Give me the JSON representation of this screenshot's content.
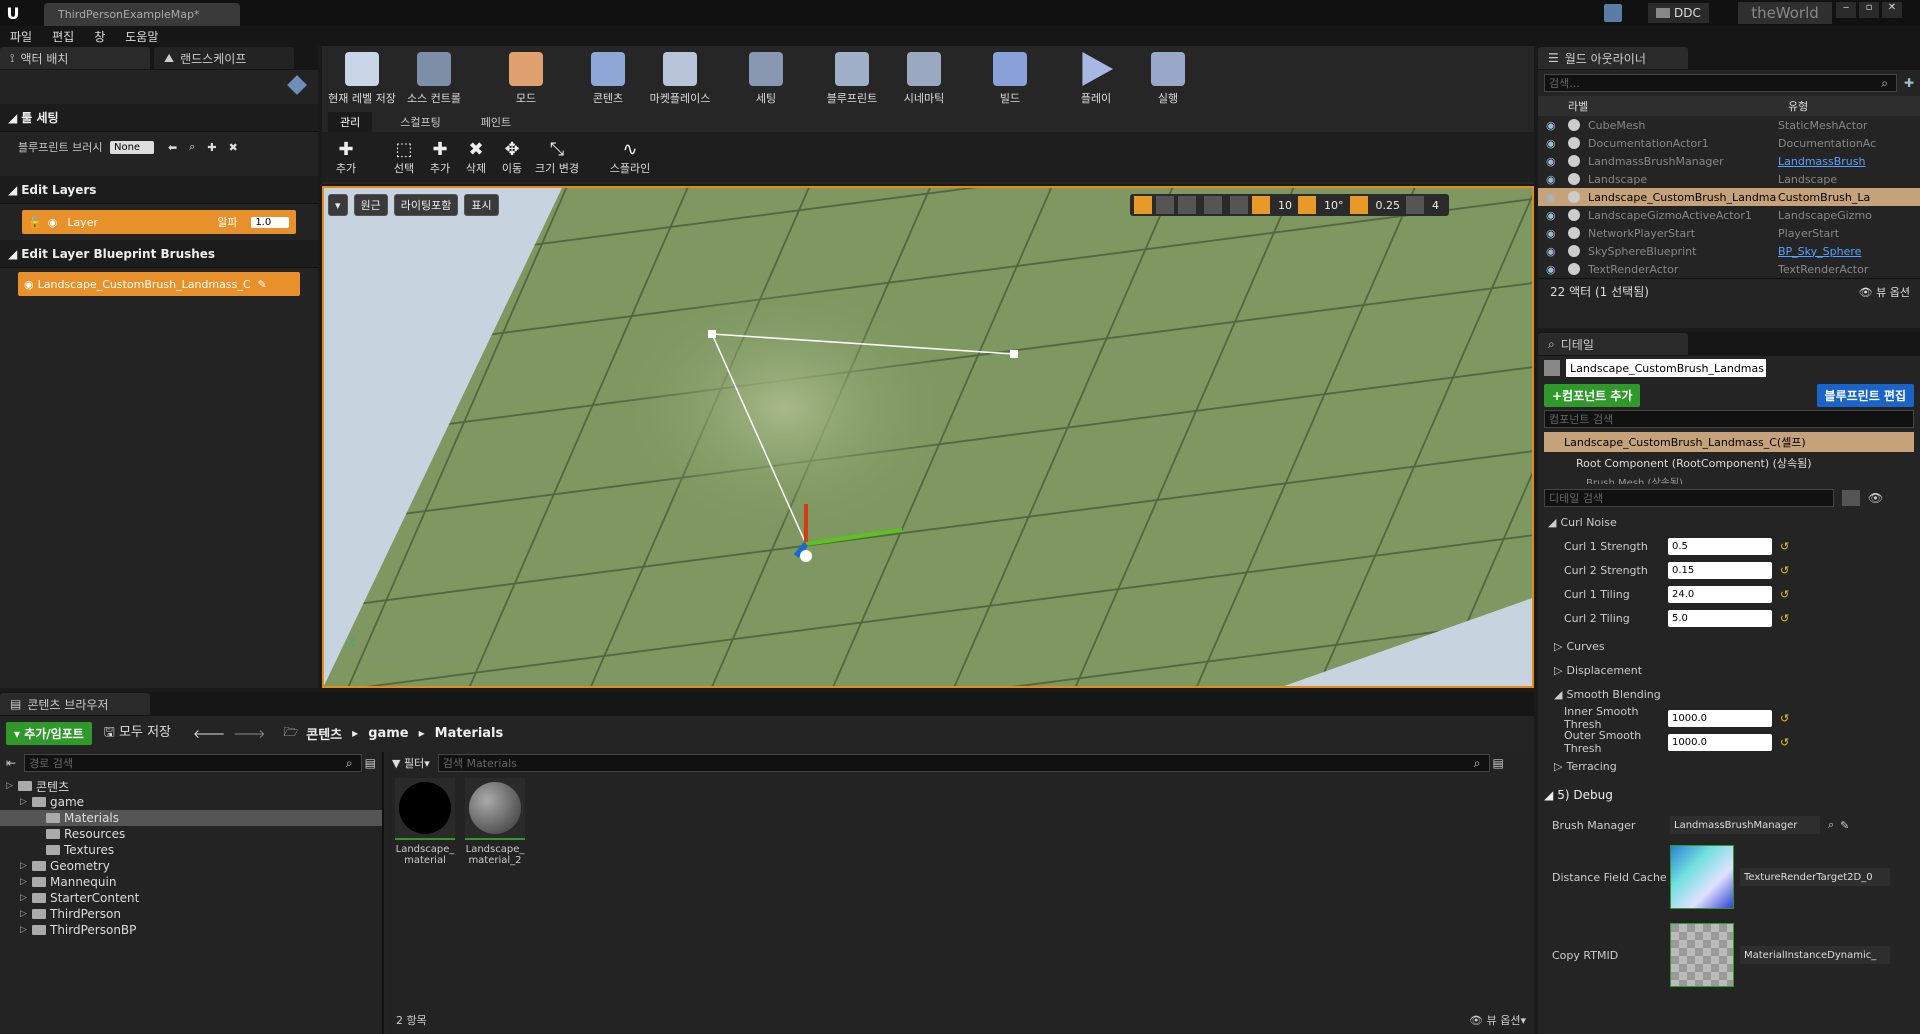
{
  "window": {
    "tab_title": "ThirdPersonExampleMap*",
    "ddc_label": "DDC",
    "world_label": "theWorld"
  },
  "menu": [
    "파일",
    "편집",
    "창",
    "도움말"
  ],
  "left_tabs": [
    "액터 배치",
    "랜드스케이프"
  ],
  "tool_settings": {
    "header": "툴 세팅",
    "blueprint_brush_label": "블루프린트 브러시",
    "blueprint_brush_value": "None"
  },
  "edit_layers": {
    "header": "Edit Layers",
    "layer_name": "Layer",
    "alpha_label": "알파",
    "alpha_value": "1.0"
  },
  "edit_layer_brushes": {
    "header": "Edit Layer Blueprint Brushes",
    "brush_name": "Landscape_CustomBrush_Landmass_C"
  },
  "toolbar": [
    {
      "label": "현재 레벨 저장",
      "icon": "save-icon",
      "color": "#c9d6e8"
    },
    {
      "label": "소스 컨트롤",
      "icon": "source-control-icon",
      "color": "#7d8fa6"
    },
    {
      "label": "모드",
      "icon": "modes-icon",
      "color": "#e0a070"
    },
    {
      "label": "콘텐츠",
      "icon": "content-icon",
      "color": "#8fa7d6"
    },
    {
      "label": "마켓플레이스",
      "icon": "marketplace-icon",
      "color": "#b8c4d8"
    },
    {
      "label": "세팅",
      "icon": "settings-icon",
      "color": "#8898b0"
    },
    {
      "label": "블루프린트",
      "icon": "blueprint-icon",
      "color": "#a0b0c8"
    },
    {
      "label": "시네마틱",
      "icon": "cinematics-icon",
      "color": "#9aa8c0"
    },
    {
      "label": "빌드",
      "icon": "build-icon",
      "color": "#8aa0d8"
    },
    {
      "label": "플레이",
      "icon": "play-icon",
      "color": "#a8b8e0"
    },
    {
      "label": "실행",
      "icon": "launch-icon",
      "color": "#98a8c8"
    }
  ],
  "mode_tabs": [
    "관리",
    "스컬프팅",
    "페인트"
  ],
  "mode_tools": [
    "추가",
    "선택",
    "추가",
    "삭제",
    "이동",
    "크기 변경",
    "스플라인"
  ],
  "viewport": {
    "perspective": "원근",
    "lighting": "라이팅포함",
    "show": "표시",
    "grid_snap": "10",
    "rot_snap": "10°",
    "scale_snap": "0.25",
    "cam_speed": "4"
  },
  "outliner": {
    "tab": "월드 아웃라이너",
    "search_placeholder": "검색...",
    "col_label": "라벨",
    "col_type": "유형",
    "rows": [
      {
        "label": "CubeMesh",
        "type": "StaticMeshActor",
        "link": false,
        "selected": false
      },
      {
        "label": "DocumentationActor1",
        "type": "DocumentationAc",
        "link": false,
        "selected": false
      },
      {
        "label": "LandmassBrushManager",
        "type": "LandmassBrush",
        "link": true,
        "selected": false
      },
      {
        "label": "Landscape",
        "type": "Landscape",
        "link": false,
        "selected": false
      },
      {
        "label": "Landscape_CustomBrush_Landma",
        "type": "CustomBrush_La",
        "link": false,
        "selected": true
      },
      {
        "label": "LandscapeGizmoActiveActor1",
        "type": "LandscapeGizmo",
        "link": false,
        "selected": false
      },
      {
        "label": "NetworkPlayerStart",
        "type": "PlayerStart",
        "link": false,
        "selected": false
      },
      {
        "label": "SkySphereBlueprint",
        "type": "BP_Sky_Sphere",
        "link": true,
        "selected": false
      },
      {
        "label": "TextRenderActor",
        "type": "TextRenderActor",
        "link": false,
        "selected": false
      }
    ],
    "count": "22 액터 (1 선택됨)",
    "view_options": "뷰 옵션"
  },
  "details": {
    "tab": "디테일",
    "name_field": "Landscape_CustomBrush_Landmas",
    "add_component": "+컴포넌트 추가",
    "edit_blueprint": "블루프린트 편집",
    "component_search_placeholder": "컴포넌트 검색",
    "self_row": "Landscape_CustomBrush_Landmass_C(셀프)",
    "root_component": "Root Component (RootComponent) (상속됨)",
    "brush_mesh": "Brush Mesh (상속됨)",
    "detail_search_placeholder": "디테일 검색",
    "curl_noise": "Curl Noise",
    "props": [
      {
        "name": "Curl 1 Strength",
        "value": "0.5"
      },
      {
        "name": "Curl 2 Strength",
        "value": "0.15"
      },
      {
        "name": "Curl 1 Tiling",
        "value": "24.0"
      },
      {
        "name": "Curl 2 Tiling",
        "value": "5.0"
      }
    ],
    "curves": "Curves",
    "displacement": "Displacement",
    "smooth_blending": "Smooth Blending",
    "smooth_props": [
      {
        "name": "Inner Smooth Thresh",
        "value": "1000.0"
      },
      {
        "name": "Outer Smooth Thresh",
        "value": "1000.0"
      }
    ],
    "terracing": "Terracing",
    "debug": "5) Debug",
    "brush_manager_label": "Brush Manager",
    "brush_manager_value": "LandmassBrushManager",
    "dfc_label": "Distance Field Cache",
    "dfc_value": "TextureRenderTarget2D_0",
    "copy_rtmid_label": "Copy RTMID",
    "copy_rtmid_value": "MaterialInstanceDynamic_"
  },
  "content_browser": {
    "tab": "콘텐츠 브라우저",
    "add_import": "추가/임포트",
    "save_all": "모두 저장",
    "breadcrumb": [
      "콘텐츠",
      "game",
      "Materials"
    ],
    "path_search_placeholder": "경로 검색",
    "filter": "필터",
    "asset_search_placeholder": "검색 Materials",
    "tree": [
      {
        "label": "콘텐츠",
        "indent": 0
      },
      {
        "label": "game",
        "indent": 1
      },
      {
        "label": "Materials",
        "indent": 2
      },
      {
        "label": "Resources",
        "indent": 2
      },
      {
        "label": "Textures",
        "indent": 2
      },
      {
        "label": "Geometry",
        "indent": 1
      },
      {
        "label": "Mannequin",
        "indent": 1
      },
      {
        "label": "StarterContent",
        "indent": 1
      },
      {
        "label": "ThirdPerson",
        "indent": 1
      },
      {
        "label": "ThirdPersonBP",
        "indent": 1
      }
    ],
    "assets": [
      {
        "line1": "Landscape_",
        "line2": "material"
      },
      {
        "line1": "Landscape_",
        "line2": "material_2"
      }
    ],
    "item_count": "2 항목",
    "view_options": "뷰 옵션"
  }
}
